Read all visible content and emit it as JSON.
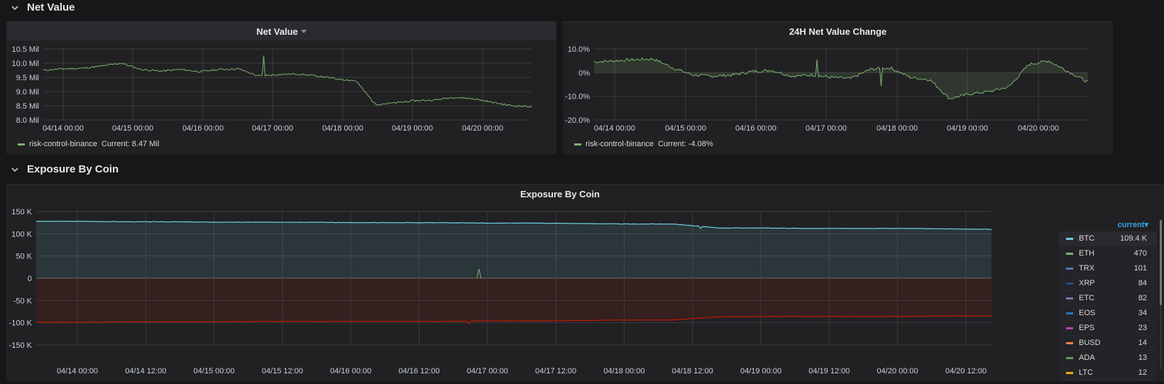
{
  "rows": [
    {
      "title": "Net Value"
    },
    {
      "title": "Exposure By Coin"
    }
  ],
  "panels": {
    "net_value": {
      "title": "Net Value",
      "legend": {
        "series": "risk-control-binance",
        "current": "Current: 8.47 Mil"
      },
      "y_ticks": [
        "10.5 Mil",
        "10.0 Mil",
        "9.5 Mil",
        "9.0 Mil",
        "8.5 Mil",
        "8.0 Mil"
      ],
      "x_ticks": [
        "04/14 00:00",
        "04/15 00:00",
        "04/16 00:00",
        "04/17 00:00",
        "04/18 00:00",
        "04/19 00:00",
        "04/20 00:00"
      ],
      "color": "#7eb26d"
    },
    "net_change": {
      "title": "24H Net Value Change",
      "legend": {
        "series": "risk-control-binance",
        "current": "Current: -4.08%"
      },
      "y_ticks": [
        "10.0%",
        "0%",
        "-10.0%",
        "-20.0%"
      ],
      "x_ticks": [
        "04/14 00:00",
        "04/15 00:00",
        "04/16 00:00",
        "04/17 00:00",
        "04/18 00:00",
        "04/19 00:00",
        "04/20 00:00"
      ],
      "color": "#7eb26d"
    },
    "exposure": {
      "title": "Exposure By Coin",
      "y_ticks": [
        "150 K",
        "100 K",
        "50 K",
        "0",
        "-50 K",
        "-100 K",
        "-150 K"
      ],
      "x_ticks": [
        "04/14 00:00",
        "04/14 12:00",
        "04/15 00:00",
        "04/15 12:00",
        "04/16 00:00",
        "04/16 12:00",
        "04/17 00:00",
        "04/17 12:00",
        "04/18 00:00",
        "04/18 12:00",
        "04/19 00:00",
        "04/19 12:00",
        "04/20 00:00",
        "04/20 12:00"
      ],
      "legend_header": "current",
      "coins": [
        {
          "name": "BTC",
          "value": "109.4 K",
          "color": "#6ed0e0"
        },
        {
          "name": "ETH",
          "value": "470",
          "color": "#7eb26d"
        },
        {
          "name": "TRX",
          "value": "101",
          "color": "#447ebc"
        },
        {
          "name": "XRP",
          "value": "84",
          "color": "#1f4b85"
        },
        {
          "name": "ETC",
          "value": "82",
          "color": "#806eb7"
        },
        {
          "name": "EOS",
          "value": "34",
          "color": "#1f78c1"
        },
        {
          "name": "EPS",
          "value": "23",
          "color": "#ba43a9"
        },
        {
          "name": "BUSD",
          "value": "14",
          "color": "#ef843c"
        },
        {
          "name": "ADA",
          "value": "13",
          "color": "#629e51"
        },
        {
          "name": "LTC",
          "value": "12",
          "color": "#e5ac0e"
        }
      ]
    }
  },
  "chart_data": [
    {
      "type": "line",
      "title": "Net Value",
      "series": [
        {
          "name": "risk-control-binance",
          "values": [
            9.75,
            9.8,
            9.82,
            9.9,
            10.0,
            9.78,
            9.72,
            9.78,
            9.7,
            9.78,
            9.8,
            9.55,
            9.6,
            9.62,
            9.55,
            9.45,
            9.38,
            8.55,
            8.6,
            8.68,
            8.7,
            8.8,
            8.75,
            8.62,
            8.5,
            8.47
          ]
        }
      ],
      "x": [
        "04/14 00:00",
        "04/14 06:00",
        "04/14 12:00",
        "04/14 18:00",
        "04/15 00:00",
        "04/15 06:00",
        "04/15 12:00",
        "04/15 18:00",
        "04/16 00:00",
        "04/16 06:00",
        "04/16 12:00",
        "04/16 18:00",
        "04/17 00:00",
        "04/17 06:00",
        "04/17 12:00",
        "04/17 18:00",
        "04/18 00:00",
        "04/18 06:00",
        "04/18 12:00",
        "04/18 18:00",
        "04/19 00:00",
        "04/19 06:00",
        "04/19 12:00",
        "04/19 18:00",
        "04/20 00:00",
        "04/20 06:00"
      ],
      "ylim": [
        8.0,
        10.5
      ],
      "grid": true
    },
    {
      "type": "area",
      "title": "24H Net Value Change",
      "series": [
        {
          "name": "risk-control-binance",
          "values": [
            4.5,
            5.0,
            5.5,
            5.8,
            2.0,
            -1.0,
            -1.5,
            -1.0,
            0.5,
            1.0,
            -1.5,
            -1.0,
            -2.0,
            -2.5,
            1.5,
            2.0,
            -2.0,
            -3.0,
            -11.0,
            -9.0,
            -8.0,
            -6.0,
            3.5,
            5.0,
            0.5,
            -4.08
          ]
        }
      ],
      "ylim": [
        -20,
        10
      ],
      "grid": true
    },
    {
      "type": "area",
      "title": "Exposure By Coin",
      "series": [
        {
          "name": "BTC",
          "values": [
            128,
            128,
            127,
            127,
            126,
            126,
            126,
            125,
            125,
            125,
            124,
            124,
            123,
            122,
            122,
            113,
            113,
            112,
            112,
            112,
            111,
            110
          ]
        },
        {
          "name": "ETH",
          "values": [
            -99,
            -99,
            -98,
            -98,
            -98,
            -97,
            -97,
            -97,
            -97,
            -97,
            -96,
            -96,
            -95,
            -94,
            -94,
            -87,
            -86,
            -86,
            -86,
            -86,
            -85,
            -85
          ]
        }
      ],
      "ylim": [
        -150,
        150
      ],
      "grid": true
    }
  ]
}
